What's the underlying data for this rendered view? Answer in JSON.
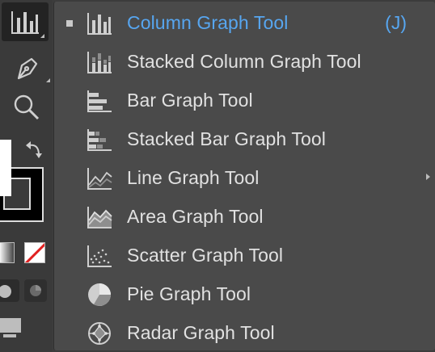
{
  "menu": {
    "items": [
      {
        "label": "Column Graph Tool",
        "icon": "column-graph-icon",
        "selected": true,
        "shortcut": "(J)"
      },
      {
        "label": "Stacked Column Graph Tool",
        "icon": "stacked-column-graph-icon"
      },
      {
        "label": "Bar Graph Tool",
        "icon": "bar-graph-icon"
      },
      {
        "label": "Stacked Bar Graph Tool",
        "icon": "stacked-bar-graph-icon"
      },
      {
        "label": "Line Graph Tool",
        "icon": "line-graph-icon"
      },
      {
        "label": "Area Graph Tool",
        "icon": "area-graph-icon"
      },
      {
        "label": "Scatter Graph Tool",
        "icon": "scatter-graph-icon"
      },
      {
        "label": "Pie Graph Tool",
        "icon": "pie-graph-icon"
      },
      {
        "label": "Radar Graph Tool",
        "icon": "radar-graph-icon"
      }
    ]
  },
  "toolbar": {
    "tools": [
      "column-graph-tool-icon",
      "pen-tool-icon",
      "zoom-tool-icon",
      "swap-colors-icon",
      "fill-swatch",
      "stroke-swatch",
      "gradient-swatch",
      "none-swatch",
      "drawing-mode-icon",
      "draw-inside-icon",
      "screen-mode-icon"
    ]
  },
  "colors": {
    "selected_text": "#57a6f0",
    "text": "#e1e1e1",
    "menu_bg": "#4a4a4a",
    "toolbar_bg": "#3a3a3a"
  }
}
